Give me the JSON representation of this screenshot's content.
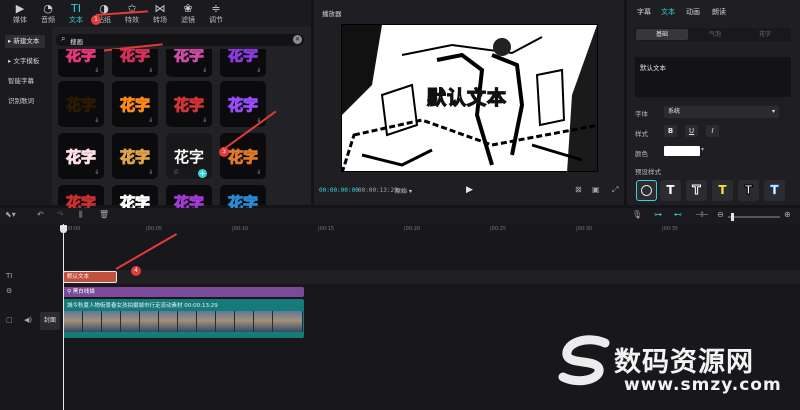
{
  "toolbar": {
    "tabs": [
      {
        "label": "媒体",
        "icon": "media-icon"
      },
      {
        "label": "音频",
        "icon": "audio-icon"
      },
      {
        "label": "文本",
        "icon": "text-icon"
      },
      {
        "label": "贴纸",
        "icon": "sticker-icon"
      },
      {
        "label": "特效",
        "icon": "effects-icon"
      },
      {
        "label": "转场",
        "icon": "transition-icon"
      },
      {
        "label": "滤镜",
        "icon": "filter-icon"
      },
      {
        "label": "调节",
        "icon": "adjust-icon"
      }
    ],
    "active_tab": "文本"
  },
  "left_sidebar": {
    "items": [
      "新建文本",
      "文字模板",
      "智能字幕",
      "识别歌词"
    ],
    "active": "新建文本"
  },
  "search": {
    "value": "搜画"
  },
  "text_presets": {
    "tile_text": "花字"
  },
  "player": {
    "title": "播放器",
    "overlay_text": "默认文本",
    "current_time": "00:00:00:00",
    "duration": "00:00:13:29",
    "ratio_label": "原始"
  },
  "inspector": {
    "tabs": [
      "字幕",
      "文本",
      "动画",
      "朗读"
    ],
    "active_tab": "文本",
    "subtabs": [
      "基础",
      "气泡",
      "花字"
    ],
    "active_subtab": "基础",
    "text_value": "默认文本",
    "font_label": "字体",
    "font_value": "系统",
    "style_label": "样式",
    "style_buttons": [
      "B",
      "U",
      "I"
    ],
    "color_label": "颜色",
    "color_value": "#ffffff",
    "preset_label": "预设样式",
    "preset_glyph": "T"
  },
  "timeline": {
    "ruler_ticks": [
      "00:00",
      "|00:05",
      "|00:10",
      "|00:15",
      "|00:20",
      "|00:25",
      "|00:30",
      "|00:35"
    ],
    "text_clip": "默认文本",
    "effect_clip": "黑白线描",
    "video_clip_label": "城今秋夏人物街景春女孩拍摄城市行走流动素材  00:00:13:29",
    "cover_label": "封面"
  },
  "annotations": [
    "1",
    "2",
    "3",
    "4"
  ],
  "watermark": {
    "title": "数码资源网",
    "url": "www.smzy.com"
  },
  "colors": {
    "accent": "#34d4d9",
    "badge": "#e53a3a",
    "text_clip": "#c0513e",
    "effect_clip": "#7b4a98",
    "video_clip": "#157a78"
  }
}
